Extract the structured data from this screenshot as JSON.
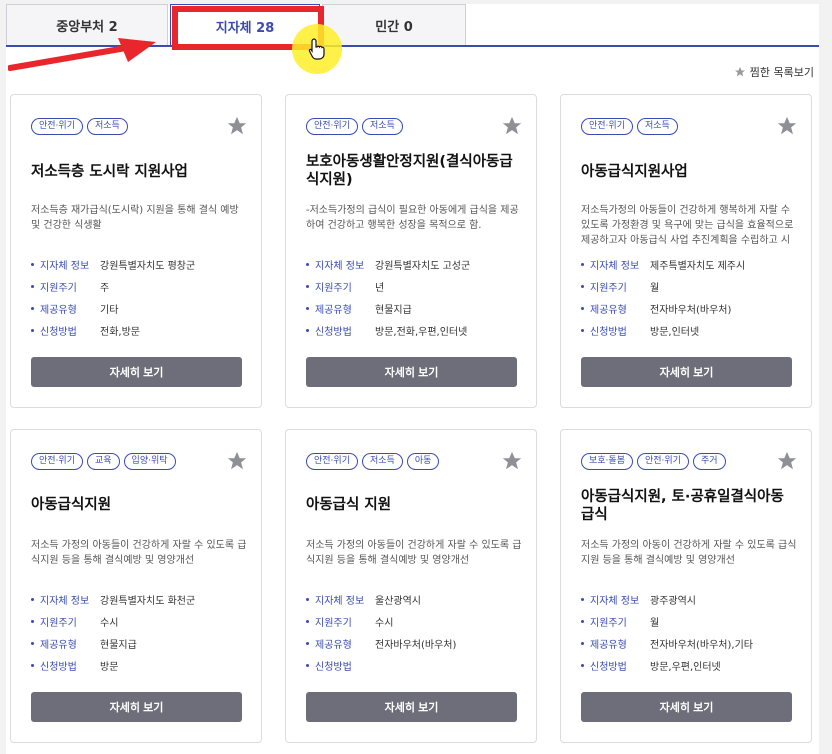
{
  "tabs": [
    {
      "label": "중앙부처 2"
    },
    {
      "label": "지자체 28"
    },
    {
      "label": "민간 0"
    }
  ],
  "favorites_link": "찜한 목록보기",
  "cards": [
    {
      "tags": [
        "안전·위기",
        "저소득"
      ],
      "title": "저소득층 도시락 지원사업",
      "desc": "저소득층 재가급식(도시락) 지원을 통해 결식 예방 및 건강한 식생활",
      "info": [
        {
          "k": "지자체 정보",
          "v": "강원특별자치도 평창군"
        },
        {
          "k": "지원주기",
          "v": "주"
        },
        {
          "k": "제공유형",
          "v": "기타"
        },
        {
          "k": "신청방법",
          "v": "전화,방문"
        }
      ],
      "button": "자세히 보기"
    },
    {
      "tags": [
        "안전·위기",
        "저소득"
      ],
      "title": "보호아동생활안정지원(결식아동급식지원)",
      "desc": "-저소득가정의 급식이 필요한 아동에게 급식을 제공하여 건강하고 행복한 성장을 목적으로 함.",
      "info": [
        {
          "k": "지자체 정보",
          "v": "강원특별자치도 고성군"
        },
        {
          "k": "지원주기",
          "v": "년"
        },
        {
          "k": "제공유형",
          "v": "현물지급"
        },
        {
          "k": "신청방법",
          "v": "방문,전화,우편,인터넷"
        }
      ],
      "button": "자세히 보기"
    },
    {
      "tags": [
        "안전·위기",
        "저소득"
      ],
      "title": "아동급식지원사업",
      "desc": "저소득가정의 아동들이 건강하게 행복하게 자랄 수 있도록 가정환경 및 욕구에 맞는 급식을 효율적으로 제공하고자 아동급식 사업 추진계획을 수립하고 시",
      "info": [
        {
          "k": "지자체 정보",
          "v": "제주특별자치도 제주시"
        },
        {
          "k": "지원주기",
          "v": "월"
        },
        {
          "k": "제공유형",
          "v": "전자바우처(바우처)"
        },
        {
          "k": "신청방법",
          "v": "방문,인터넷"
        }
      ],
      "button": "자세히 보기"
    },
    {
      "tags": [
        "안전·위기",
        "교육",
        "입양·위탁"
      ],
      "title": "아동급식지원",
      "desc": "저소득 가정의 아동들이 건강하게 자랄 수 있도록 급식지원 등을 통해 결식예방 및 영양개선",
      "info": [
        {
          "k": "지자체 정보",
          "v": "강원특별자치도 화천군"
        },
        {
          "k": "지원주기",
          "v": "수시"
        },
        {
          "k": "제공유형",
          "v": "현물지급"
        },
        {
          "k": "신청방법",
          "v": "방문"
        }
      ],
      "button": "자세히 보기"
    },
    {
      "tags": [
        "안전·위기",
        "저소득",
        "아동"
      ],
      "title": "아동급식 지원",
      "desc": "저소득 가정의 아동들이 건강하게 자랄 수 있도록 급식지원 등을 통해 결식예방 및 영양개선",
      "info": [
        {
          "k": "지자체 정보",
          "v": "울산광역시"
        },
        {
          "k": "지원주기",
          "v": "수시"
        },
        {
          "k": "제공유형",
          "v": "전자바우처(바우처)"
        },
        {
          "k": "신청방법",
          "v": ""
        }
      ],
      "button": "자세히 보기"
    },
    {
      "tags": [
        "보호·돌봄",
        "안전·위기",
        "주거"
      ],
      "title": "아동급식지원, 토·공휴일결식아동급식",
      "desc": "저소득 가정의 아동이 건강하게 자랄 수 있도록 급식지원 등을 통해 결식예방 및 영양개선",
      "info": [
        {
          "k": "지자체 정보",
          "v": "광주광역시"
        },
        {
          "k": "지원주기",
          "v": "월"
        },
        {
          "k": "제공유형",
          "v": "전자바우처(바우처),기타"
        },
        {
          "k": "신청방법",
          "v": "방문,우편,인터넷"
        }
      ],
      "button": "자세히 보기"
    }
  ],
  "colors": {
    "accent": "#3a4cb0",
    "annotation": "#e8262b",
    "button": "#6e6e7a",
    "highlight": "#ffee28"
  }
}
